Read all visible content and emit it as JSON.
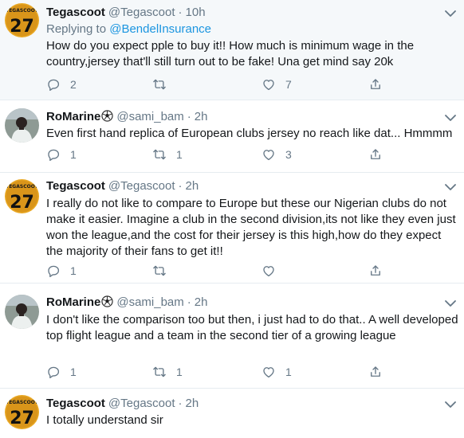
{
  "colors": {
    "name": "#14171a",
    "muted": "#657786",
    "link": "#1b95e0",
    "highlight_bg": "#f5f8fa",
    "border": "#e6ecf0"
  },
  "tweets": [
    {
      "name": "Tegascoot",
      "handle": "@Tegascoot",
      "time": "10h",
      "replying_prefix": "Replying to",
      "replying_to": "@BendelInsurance",
      "text": "How do you expect pple to buy it!! How much is minimum wage in the country,jersey that'll still turn out to be fake! Una get mind say 20k",
      "replies": "2",
      "retweets": "",
      "likes": "7",
      "avatar_text": "27",
      "avatar_caption": "TEGASCOOT"
    },
    {
      "name": "RoMarine",
      "handle": "@sami_bam",
      "time": "2h",
      "text": "Even first hand replica of European clubs jersey no reach like dat... Hmmmm",
      "replies": "1",
      "retweets": "1",
      "likes": "3"
    },
    {
      "name": "Tegascoot",
      "handle": "@Tegascoot",
      "time": "2h",
      "text": "I really do not like to compare to Europe but these our Nigerian clubs do not make it easier. Imagine a club in the second division,its not like they even just won the league,and the cost for their jersey is this high,how do they expect the majority of their fans to get it!!",
      "replies": "1",
      "retweets": "",
      "likes": "",
      "avatar_text": "27",
      "avatar_caption": "TEGASCOOT"
    },
    {
      "name": "RoMarine",
      "handle": "@sami_bam",
      "time": "2h",
      "text": "I don't like the comparison too but then, i just had to do that.. A well developed top flight league and a team in the second tier of a growing league",
      "replies": "1",
      "retweets": "1",
      "likes": "1"
    },
    {
      "name": "Tegascoot",
      "handle": "@Tegascoot",
      "time": "2h",
      "text": "I totally understand sir",
      "avatar_text": "27",
      "avatar_caption": "TEGASCOOT"
    }
  ],
  "dot": "·"
}
